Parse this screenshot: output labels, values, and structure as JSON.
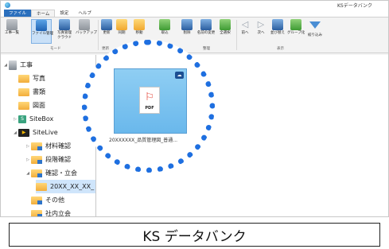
{
  "window": {
    "title": "KSデータバンク"
  },
  "tabs": [
    "ファイル",
    "ホーム",
    "設定",
    "ヘルプ"
  ],
  "ribbon": {
    "buttons": [
      {
        "label": "工事一覧",
        "icon": "construction-list-icon"
      },
      {
        "label": "ファイル管理",
        "icon": "file-management-icon"
      },
      {
        "label": "写真管理",
        "label2": "クラウド",
        "icon": "photo-cloud-icon"
      },
      {
        "label": "バックアップ",
        "icon": "backup-icon"
      },
      {
        "label": "更新",
        "icon": "update-icon"
      },
      {
        "label": "同期",
        "icon": "sync-icon"
      },
      {
        "label": "移動",
        "icon": "move-icon"
      },
      {
        "label": "取込",
        "icon": "import-icon"
      },
      {
        "label": "削除",
        "icon": "delete-icon"
      },
      {
        "label": "名前の変更",
        "icon": "rename-icon"
      },
      {
        "label": "全選択",
        "icon": "select-all-icon"
      },
      {
        "label": "前へ",
        "icon": "prev-icon"
      },
      {
        "label": "次へ",
        "icon": "next-icon"
      },
      {
        "label": "並び替え",
        "icon": "sort-icon"
      },
      {
        "label": "グループ化",
        "icon": "group-icon"
      },
      {
        "label": "絞り込み",
        "icon": "filter-icon"
      }
    ],
    "groups": [
      "モード",
      "更新",
      "データ",
      "整理",
      "表示"
    ]
  },
  "tree": [
    {
      "label": "工事",
      "level": 0,
      "expanded": true
    },
    {
      "label": "写真",
      "level": 1
    },
    {
      "label": "書類",
      "level": 1
    },
    {
      "label": "図面",
      "level": 1
    },
    {
      "label": "SiteBox",
      "level": 1
    },
    {
      "label": "SiteLive",
      "level": 1,
      "expanded": true
    },
    {
      "label": "材料確認",
      "level": 2
    },
    {
      "label": "段階確認",
      "level": 2
    },
    {
      "label": "確認・立会",
      "level": 2,
      "expanded": true
    },
    {
      "label": "20XX_XX_XX_",
      "level": 3,
      "selected": true
    },
    {
      "label": "その他",
      "level": 1
    },
    {
      "label": "社内立会",
      "level": 1
    }
  ],
  "file": {
    "name": "20XXXXXX_品質管理図_普通...",
    "type_label": "PDF",
    "symbol": "⊱"
  },
  "caption": "KS データバンク",
  "colors": {
    "accent": "#2a6fbd",
    "highlight_ring": "#1e6fe0",
    "selection": "#cfe5fb"
  }
}
